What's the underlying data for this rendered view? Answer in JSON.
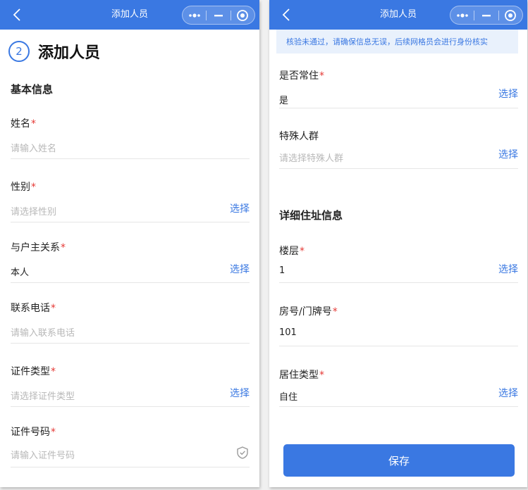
{
  "left": {
    "nav": {
      "title": "添加人员"
    },
    "heading": {
      "step": "2",
      "title": "添加人员"
    },
    "section": {
      "title": "基本信息"
    },
    "fields": [
      {
        "label": "姓名",
        "required": "*",
        "value": "",
        "placeholder": "请输入姓名",
        "action": ""
      },
      {
        "label": "性别",
        "required": "*",
        "value": "",
        "placeholder": "请选择性别",
        "action": "选择"
      },
      {
        "label": "与户主关系",
        "required": "*",
        "value": "本人",
        "placeholder": "",
        "action": "选择"
      },
      {
        "label": "联系电话",
        "required": "*",
        "value": "",
        "placeholder": "请输入联系电话",
        "action": ""
      },
      {
        "label": "证件类型",
        "required": "*",
        "value": "",
        "placeholder": "请选择证件类型",
        "action": "选择"
      },
      {
        "label": "证件号码",
        "required": "*",
        "value": "",
        "placeholder": "请输入证件号码",
        "action": "",
        "icon": "shield-check-icon"
      }
    ]
  },
  "right": {
    "nav": {
      "title": "添加人员"
    },
    "notice": "核验未通过，请确保信息无误，后续网格员会进行身份核实",
    "fields_top": [
      {
        "label": "是否常住",
        "required": "*",
        "value": "是",
        "placeholder": "",
        "action": "选择"
      },
      {
        "label": "特殊人群",
        "required": "",
        "value": "",
        "placeholder": "请选择特殊人群",
        "action": "选择"
      }
    ],
    "section": {
      "title": "详细住址信息"
    },
    "fields_bottom": [
      {
        "label": "楼层",
        "required": "*",
        "value": "1",
        "placeholder": "",
        "action": "选择"
      },
      {
        "label": "房号/门牌号",
        "required": "*",
        "value": "101",
        "placeholder": "",
        "action": ""
      },
      {
        "label": "居住类型",
        "required": "*",
        "value": "自住",
        "placeholder": "",
        "action": "选择"
      }
    ],
    "save_label": "保存"
  },
  "colors": {
    "primary": "#3a78e2",
    "required": "#e53935",
    "placeholder": "#b8b8b8",
    "notice_bg": "#e9f1fc"
  },
  "capsule_icons": [
    "more-dots-icon",
    "minimize-icon",
    "close-target-icon"
  ]
}
